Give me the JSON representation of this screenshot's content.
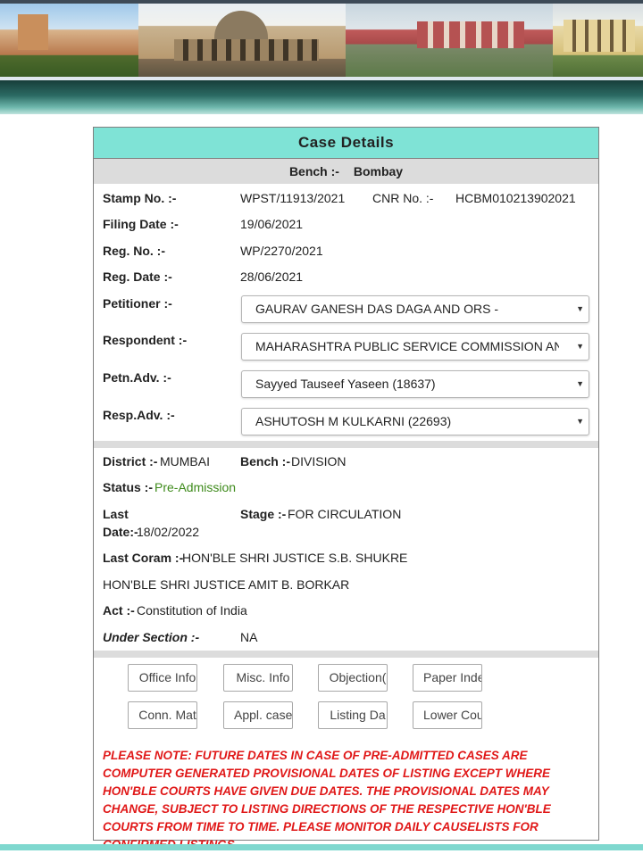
{
  "case": {
    "title": "Case Details",
    "bench_label": "Bench :-",
    "bench_value": "Bombay",
    "stamp_label": "Stamp No. :-",
    "stamp_value": "WPST/11913/2021",
    "cnr_label": "CNR No. :-",
    "cnr_value": "HCBM010213902021",
    "filing_label": "Filing Date :-",
    "filing_value": "19/06/2021",
    "reg_no_label": "Reg. No. :-",
    "reg_no_value": "WP/2270/2021",
    "reg_date_label": "Reg. Date :-",
    "reg_date_value": "28/06/2021",
    "petitioner_label": "Petitioner :-",
    "petitioner_value": "GAURAV GANESH DAS DAGA AND ORS -",
    "respondent_label": "Respondent :-",
    "respondent_value": "MAHARASHTRA PUBLIC SERVICE COMMISSION AND A",
    "petn_adv_label": "Petn.Adv. :-",
    "petn_adv_value": "Sayyed Tauseef Yaseen (18637)",
    "resp_adv_label": "Resp.Adv. :-",
    "resp_adv_value": "ASHUTOSH M KULKARNI (22693)"
  },
  "status": {
    "district_label": "District :-",
    "district_value": "MUMBAI",
    "bench_label": "Bench :-",
    "bench_value": "DIVISION",
    "status_label": "Status :-",
    "status_value": "Pre-Admission",
    "last_date_label_1": "Last",
    "last_date_label_2": "Date:-",
    "last_date_value": "18/02/2022",
    "stage_label": "Stage :-",
    "stage_value": "FOR CIRCULATION",
    "coram_label": "Last Coram :-",
    "coram_value_1": "HON'BLE SHRI JUSTICE S.B. SHUKRE",
    "coram_value_2": "HON'BLE SHRI JUSTICE AMIT B. BORKAR",
    "act_label": "Act :-",
    "act_value": "Constitution of India",
    "section_label": "Under Section :-",
    "section_value": "NA"
  },
  "buttons": {
    "office_info": "Office Info",
    "misc_info": "Misc. Info",
    "objection": "Objection(",
    "paper_index": "Paper Inde",
    "conn_matters": "Conn. Mat",
    "appl_case": "Appl. case",
    "listing_dates": "Listing Da",
    "lower_court": "Lower Cou"
  },
  "note": "PLEASE NOTE: FUTURE DATES IN CASE OF PRE-ADMITTED CASES ARE COMPUTER GENERATED PROVISIONAL DATES OF LISTING EXCEPT WHERE HON'BLE COURTS HAVE GIVEN DUE DATES. THE PROVISIONAL DATES MAY CHANGE, SUBJECT TO LISTING DIRECTIONS OF THE RESPECTIVE HON'BLE COURTS FROM TIME TO TIME. PLEASE MONITOR DAILY CAUSELISTS FOR CONFIRMED LISTINGS.",
  "colors": {
    "title_bar": "#7fe3d6",
    "status_green": "#3d8a1a",
    "note_red": "#e01818"
  },
  "icons": [
    "dropdown-caret-icon"
  ]
}
